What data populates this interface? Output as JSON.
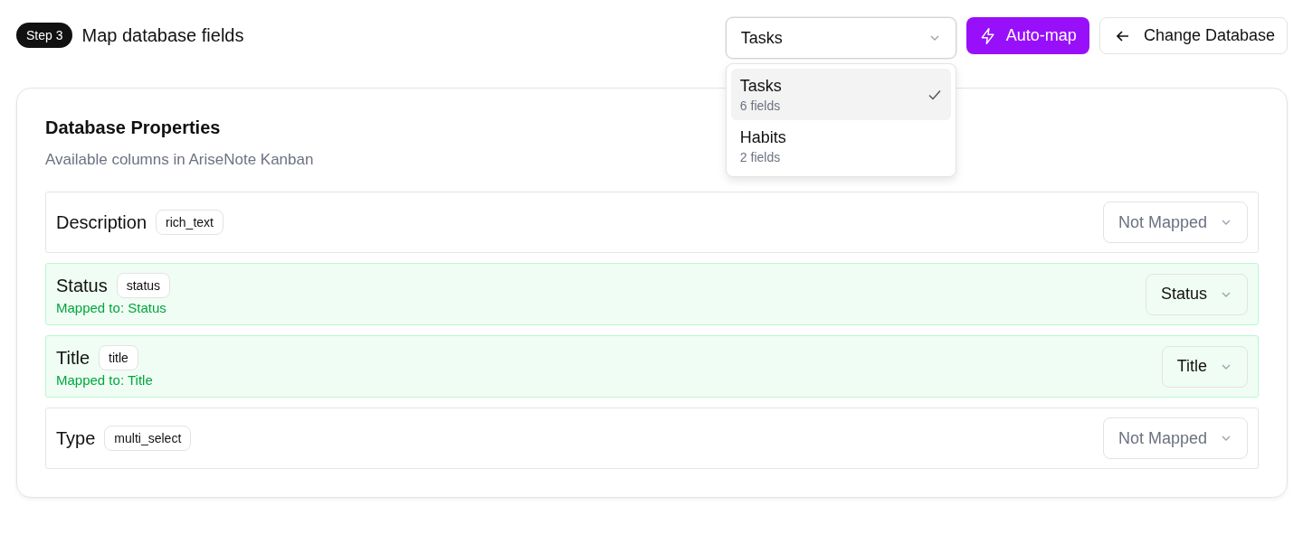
{
  "header": {
    "step": "Step 3",
    "title": "Map database fields"
  },
  "database_select": {
    "value": "Tasks",
    "expanded": true,
    "options": [
      {
        "label": "Tasks",
        "count": "6 fields",
        "selected": true
      },
      {
        "label": "Habits",
        "count": "2 fields",
        "selected": false
      }
    ]
  },
  "buttons": {
    "auto_map": "Auto-map",
    "change_database": "Change Database"
  },
  "card": {
    "title": "Database Properties",
    "subtitle": "Available columns in AriseNote Kanban",
    "properties": [
      {
        "name": "Description",
        "type": "rich_text",
        "mapped": false,
        "select": "Not Mapped"
      },
      {
        "name": "Status",
        "type": "status",
        "mapped": true,
        "mapped_text": "Mapped to: Status",
        "select": "Status"
      },
      {
        "name": "Title",
        "type": "title",
        "mapped": true,
        "mapped_text": "Mapped to: Title",
        "select": "Title"
      },
      {
        "name": "Type",
        "type": "multi_select",
        "mapped": false,
        "select": "Not Mapped"
      }
    ]
  }
}
